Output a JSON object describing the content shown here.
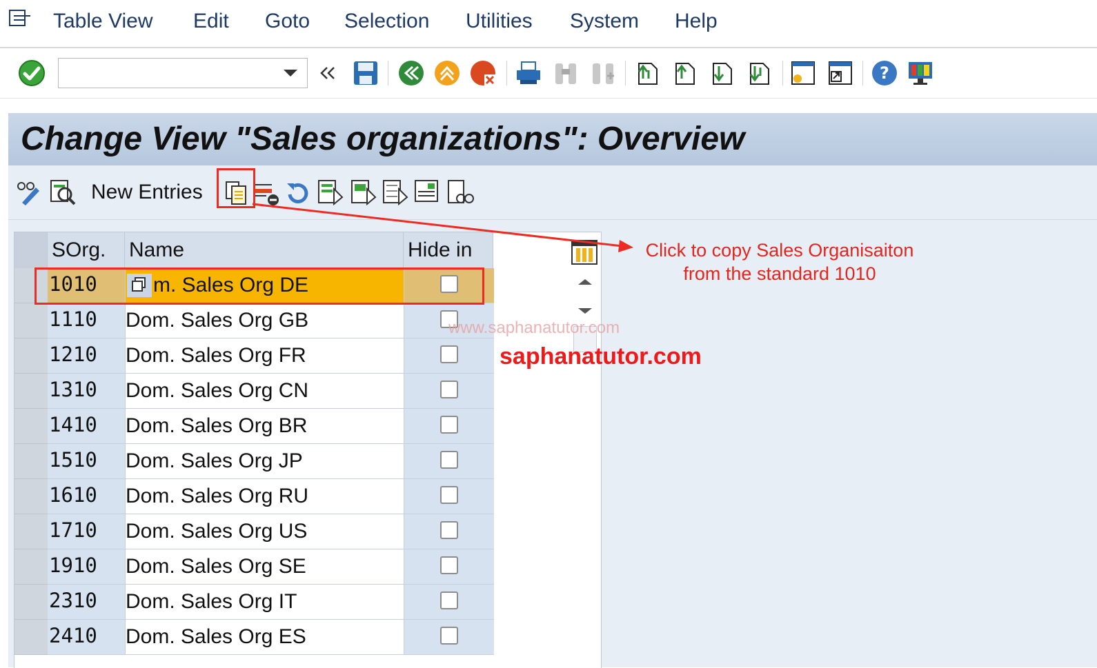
{
  "menubar": {
    "items": [
      "Table View",
      "Edit",
      "Goto",
      "Selection",
      "Utilities",
      "System",
      "Help"
    ]
  },
  "toolbar": {
    "command_value": "",
    "icons": [
      "enter-icon",
      "save-icon",
      "back-icon",
      "exit-icon",
      "cancel-icon",
      "print-icon",
      "find-icon",
      "find-next-icon",
      "first-page-icon",
      "previous-page-icon",
      "next-page-icon",
      "last-page-icon",
      "create-session-icon",
      "shortcut-icon",
      "help-icon",
      "customize-layout-icon"
    ]
  },
  "title": "Change View \"Sales organizations\": Overview",
  "app_toolbar": {
    "new_entries_label": "New Entries"
  },
  "table": {
    "columns": [
      "SOrg.",
      "Name",
      "Hide in"
    ],
    "rows": [
      {
        "sorg": "1010",
        "name": "m. Sales Org DE",
        "hide": false,
        "highlighted": true
      },
      {
        "sorg": "1110",
        "name": "Dom. Sales Org GB",
        "hide": false
      },
      {
        "sorg": "1210",
        "name": "Dom. Sales Org FR",
        "hide": false
      },
      {
        "sorg": "1310",
        "name": "Dom. Sales Org CN",
        "hide": false
      },
      {
        "sorg": "1410",
        "name": "Dom. Sales Org BR",
        "hide": false
      },
      {
        "sorg": "1510",
        "name": "Dom. Sales Org JP",
        "hide": false
      },
      {
        "sorg": "1610",
        "name": "Dom. Sales Org RU",
        "hide": false
      },
      {
        "sorg": "1710",
        "name": "Dom. Sales Org US",
        "hide": false
      },
      {
        "sorg": "1910",
        "name": "Dom. Sales Org SE",
        "hide": false
      },
      {
        "sorg": "2310",
        "name": "Dom. Sales Org IT",
        "hide": false
      },
      {
        "sorg": "2410",
        "name": "Dom. Sales Org ES",
        "hide": false
      }
    ]
  },
  "annotation": {
    "line1": "Click to copy Sales Organisaiton",
    "line2": "from the standard 1010"
  },
  "watermark_small": "www.saphanatutor.com",
  "watermark_big": "saphanatutor.com",
  "colors": {
    "accent_red": "#ee2b22",
    "highlight_row": "#f8b500",
    "title_bg": "#bfd0e4"
  }
}
